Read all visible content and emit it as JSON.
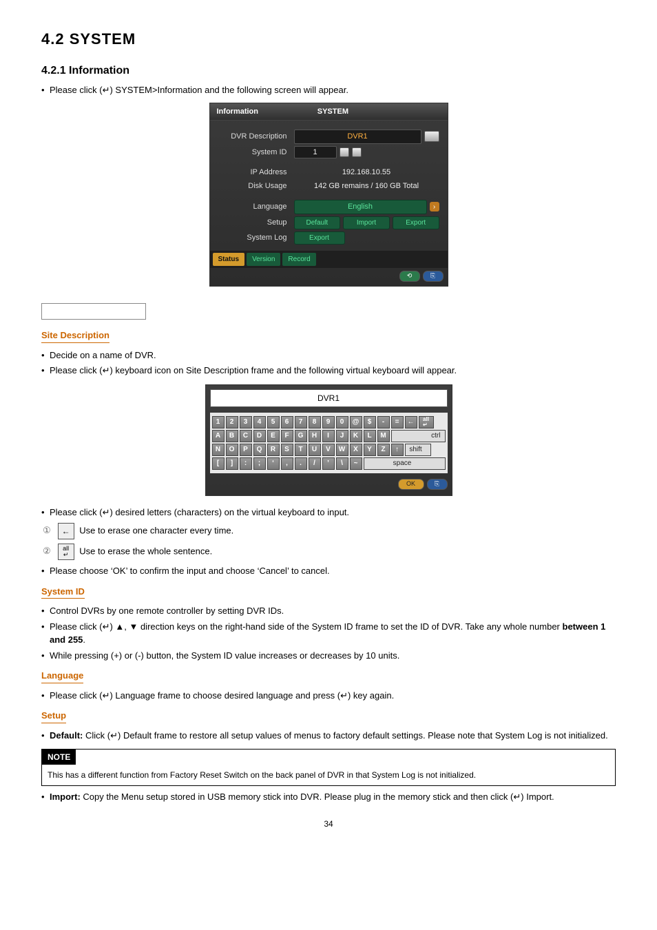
{
  "heading_section": "4.2  SYSTEM",
  "heading_sub": "4.2.1  Information",
  "intro_bullet": "Please click (↵) SYSTEM>Information and the following screen will appear.",
  "panel": {
    "tab_left": "Information",
    "tab_right": "SYSTEM",
    "rows": {
      "dvr_desc_label": "DVR Description",
      "dvr_desc_value": "DVR1",
      "system_id_label": "System ID",
      "system_id_value": "1",
      "ip_label": "IP Address",
      "ip_value": "192.168.10.55",
      "disk_label": "Disk Usage",
      "disk_value": "142 GB remains  /  160 GB Total",
      "lang_label": "Language",
      "lang_value": "English",
      "setup_label": "Setup",
      "setup_default": "Default",
      "setup_import": "Import",
      "setup_export": "Export",
      "syslog_label": "System Log",
      "syslog_export": "Export"
    },
    "tabs": {
      "status": "Status",
      "version": "Version",
      "record": "Record"
    }
  },
  "sec_site_desc": "Site Description",
  "site_desc_b1": "Decide on a name of DVR.",
  "site_desc_b2": "Please click (↵) keyboard icon on Site Description frame and the following virtual keyboard will appear.",
  "vk": {
    "display": "DVR1",
    "row1": [
      "1",
      "2",
      "3",
      "4",
      "5",
      "6",
      "7",
      "8",
      "9",
      "0",
      "@",
      "$",
      "-",
      "=",
      "←",
      "all↵"
    ],
    "row2": [
      "A",
      "B",
      "C",
      "D",
      "E",
      "F",
      "G",
      "H",
      "I",
      "J",
      "K",
      "L",
      "M"
    ],
    "row2_wide": "ctrl",
    "row3": [
      "N",
      "O",
      "P",
      "Q",
      "R",
      "S",
      "T",
      "U",
      "V",
      "W",
      "X",
      "Y",
      "Z",
      "↑"
    ],
    "row3_wide": "shift",
    "row4": [
      "[",
      "]",
      ":",
      ";",
      "‘",
      ",",
      ".",
      "/",
      "’",
      "\\",
      "~"
    ],
    "row4_wide": "space",
    "ok": "OK"
  },
  "after_vk_b1": "Please click (↵) desired letters (characters) on the virtual keyboard to input.",
  "enum1_pre": "①",
  "enum1_icon": "←",
  "enum1_text": " Use to erase one character every time.",
  "enum2_pre": "②",
  "enum2_icon": "all↵",
  "enum2_text": " Use to erase the whole sentence.",
  "after_vk_b2": "Please choose ‘OK’ to confirm the input and choose ‘Cancel’ to cancel.",
  "sec_system_id": "System ID",
  "sysid_b1": "Control DVRs by one remote controller by setting DVR IDs.",
  "sysid_b2_a": "Please click (↵) ▲, ▼ direction keys on the right-hand side of the System ID frame to set the ID of DVR. Take any whole number ",
  "sysid_b2_bold": "between 1 and 255",
  "sysid_b2_c": ".",
  "sysid_b3": "While pressing (+) or (-) button, the System ID value increases or decreases by 10 units.",
  "sec_language": "Language",
  "lang_b1": "Please click (↵) Language frame to choose desired language and press (↵) key again.",
  "sec_setup": "Setup",
  "setup_b1_bold": "Default:",
  "setup_b1_rest": " Click (↵) Default frame to restore all setup values of menus to factory default settings. Please note that System Log is not initialized.",
  "note_head": "NOTE",
  "note_body": "This has a different function from Factory Reset Switch on the back panel of DVR in that System Log is not initialized.",
  "import_bold": "Import:",
  "import_rest": " Copy the Menu setup stored in USB memory stick into DVR. Please plug in the memory stick and then click (↵) Import.",
  "page_num": "34"
}
